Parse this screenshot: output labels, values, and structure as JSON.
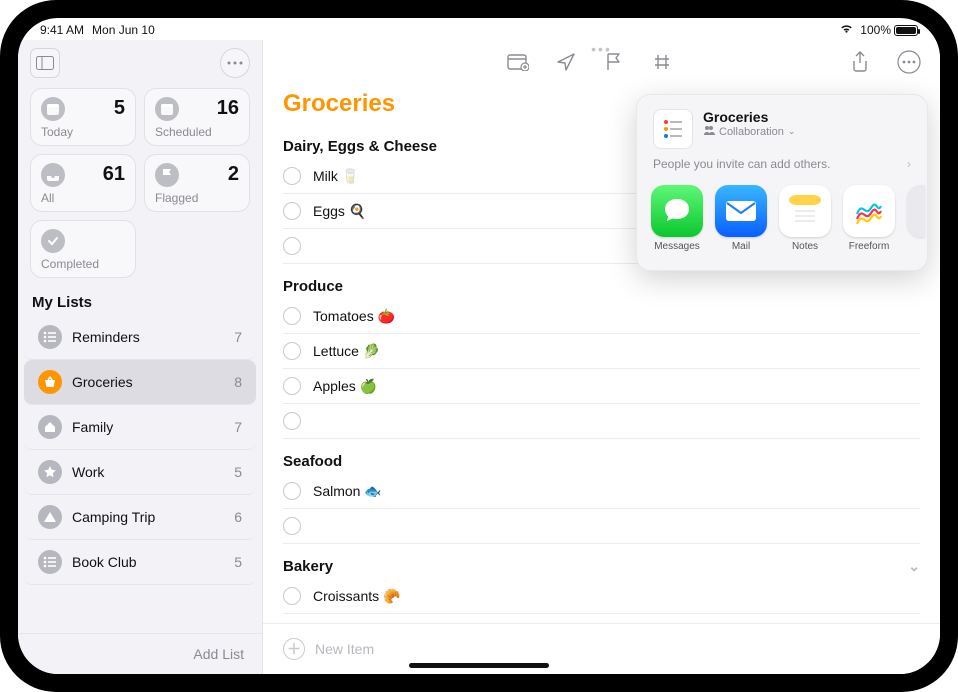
{
  "statusbar": {
    "time": "9:41 AM",
    "date": "Mon Jun 10",
    "battery_percent": "100%"
  },
  "sidebar": {
    "smart_lists": [
      {
        "label": "Today",
        "count": "5",
        "icon": "calendar-icon"
      },
      {
        "label": "Scheduled",
        "count": "16",
        "icon": "calendar-icon"
      },
      {
        "label": "All",
        "count": "61",
        "icon": "tray-icon"
      },
      {
        "label": "Flagged",
        "count": "2",
        "icon": "flag-icon"
      }
    ],
    "completed_label": "Completed",
    "section_title": "My Lists",
    "lists": [
      {
        "name": "Reminders",
        "count": "7",
        "selected": false,
        "icon": "list-icon"
      },
      {
        "name": "Groceries",
        "count": "8",
        "selected": true,
        "icon": "basket-icon"
      },
      {
        "name": "Family",
        "count": "7",
        "selected": false,
        "icon": "house-icon"
      },
      {
        "name": "Work",
        "count": "5",
        "selected": false,
        "icon": "star-icon"
      },
      {
        "name": "Camping Trip",
        "count": "6",
        "selected": false,
        "icon": "tent-icon"
      },
      {
        "name": "Book Club",
        "count": "5",
        "selected": false,
        "icon": "list-icon"
      }
    ],
    "footer": "Add List"
  },
  "main": {
    "title": "Groceries",
    "new_item_placeholder": "New Item",
    "sections": [
      {
        "header": "Dairy, Eggs & Cheese",
        "items": [
          {
            "text": "Milk 🥛"
          },
          {
            "text": "Eggs 🍳"
          }
        ],
        "has_empty": true
      },
      {
        "header": "Produce",
        "items": [
          {
            "text": "Tomatoes 🍅"
          },
          {
            "text": "Lettuce 🥬"
          },
          {
            "text": "Apples 🍏"
          }
        ],
        "has_empty": true
      },
      {
        "header": "Seafood",
        "items": [
          {
            "text": "Salmon 🐟"
          }
        ],
        "has_empty": true
      },
      {
        "header": "Bakery",
        "collapsible": true,
        "items": [
          {
            "text": "Croissants 🥐"
          }
        ],
        "has_empty": false
      }
    ]
  },
  "share": {
    "title": "Groceries",
    "subtitle": "Collaboration",
    "invite_text": "People you invite can add others.",
    "apps": [
      {
        "name": "Messages",
        "icon": "messages"
      },
      {
        "name": "Mail",
        "icon": "mail"
      },
      {
        "name": "Notes",
        "icon": "notes"
      },
      {
        "name": "Freeform",
        "icon": "freeform"
      }
    ]
  }
}
